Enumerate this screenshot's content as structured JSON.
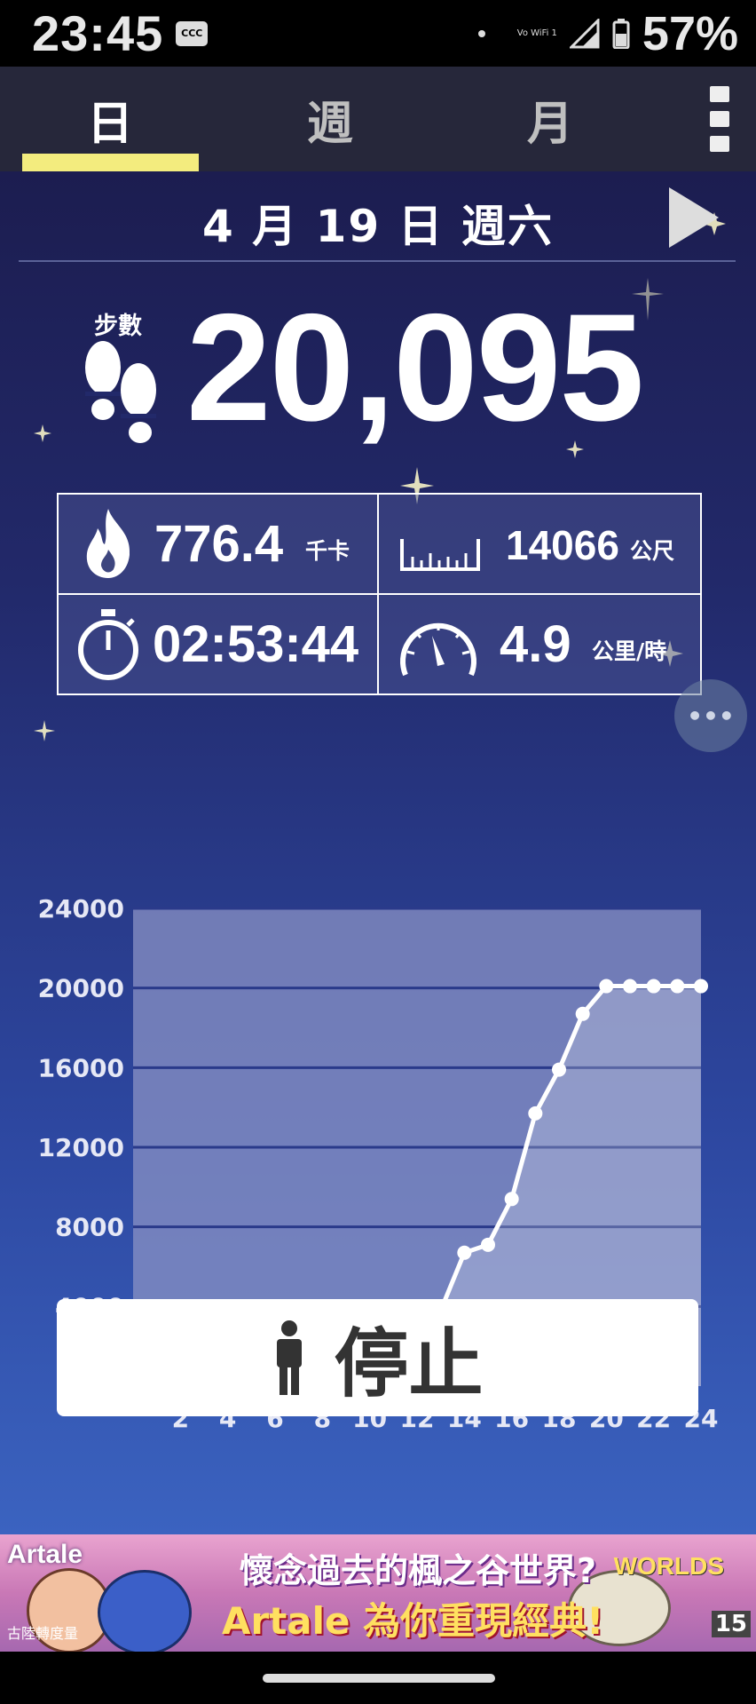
{
  "status_bar": {
    "time": "23:45",
    "carrier_icon": "CCC",
    "vowifi": "Vo WiFi 1",
    "battery": "57%"
  },
  "tabs": [
    {
      "label": "日",
      "selected": true
    },
    {
      "label": "週",
      "selected": false
    },
    {
      "label": "月",
      "selected": false
    }
  ],
  "date_header": {
    "date": "4 月 19 日 週六"
  },
  "steps": {
    "label": "步數",
    "value": "20,095"
  },
  "stats": {
    "calories": {
      "value": "776.4",
      "unit": "千卡",
      "icon": "flame-icon"
    },
    "distance": {
      "value": "14066",
      "unit": "公尺",
      "icon": "ruler-icon"
    },
    "duration": {
      "value": "02:53:44",
      "icon": "stopwatch-icon"
    },
    "speed": {
      "value": "4.9",
      "unit": "公里/時",
      "icon": "speedometer-icon"
    }
  },
  "chart_data": {
    "type": "line",
    "x_ticks": [
      "2",
      "4",
      "6",
      "8",
      "10",
      "12",
      "14",
      "16",
      "18",
      "20",
      "22",
      "24"
    ],
    "y_ticks": [
      "4000",
      "8000",
      "12000",
      "16000",
      "20000",
      "24000"
    ],
    "ylim": [
      0,
      24000
    ],
    "xlim": [
      0,
      24
    ],
    "grid": true,
    "x": [
      0,
      1,
      2,
      3,
      4,
      5,
      6,
      7,
      8,
      9,
      10,
      11,
      12,
      13,
      14,
      15,
      16,
      17,
      18,
      19,
      20,
      21,
      22,
      23,
      24
    ],
    "values": [
      0,
      0,
      0,
      0,
      0,
      0,
      0,
      0,
      0,
      0,
      0,
      0,
      0,
      3800,
      6700,
      7100,
      9400,
      13700,
      15900,
      18700,
      20095,
      20095,
      20095,
      20095,
      20095
    ],
    "colors": {
      "line": "#ffffff",
      "plot_bg": "#8a92c4"
    }
  },
  "stop_button": {
    "label": "停止",
    "icon": "person-icon"
  },
  "ad": {
    "brand": "Artale",
    "line1": "懷念過去的楓之谷世界?",
    "line2": "Artale 為你重現經典!",
    "tag": "古陸轉度量",
    "world": "WORLDS",
    "rating": "15"
  }
}
